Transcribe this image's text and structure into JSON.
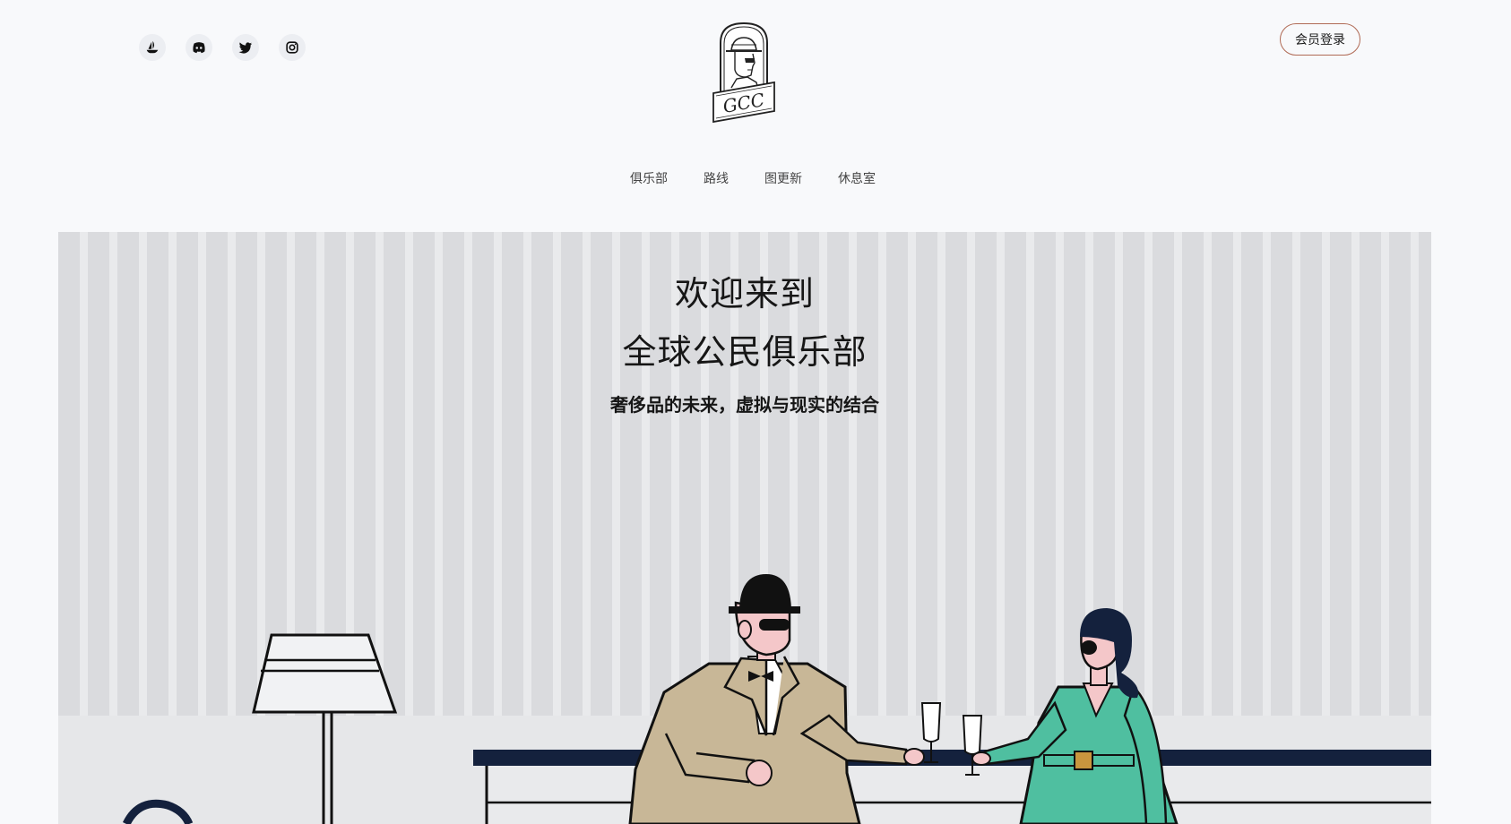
{
  "header": {
    "social": [
      {
        "icon": "opensea-boat-icon",
        "name": "social-opensea"
      },
      {
        "icon": "discord-icon",
        "name": "social-discord"
      },
      {
        "icon": "twitter-icon",
        "name": "social-twitter"
      },
      {
        "icon": "instagram-icon",
        "name": "social-instagram"
      }
    ],
    "logo_text": "GCC",
    "login_label": "会员登录"
  },
  "nav": {
    "items": [
      "俱乐部",
      "路线",
      "图更新",
      "休息室"
    ]
  },
  "hero": {
    "title_line1": "欢迎来到",
    "title_line2": "全球公民俱乐部",
    "subtitle": "奢侈品的未来，虚拟与现实的结合"
  },
  "colors": {
    "background": "#f8f9fb",
    "wall_stripe": "#dadbde",
    "bar_top": "#14213d",
    "suit": "#c8b797",
    "dress": "#4fbfa0",
    "login_border": "#b06a55"
  }
}
